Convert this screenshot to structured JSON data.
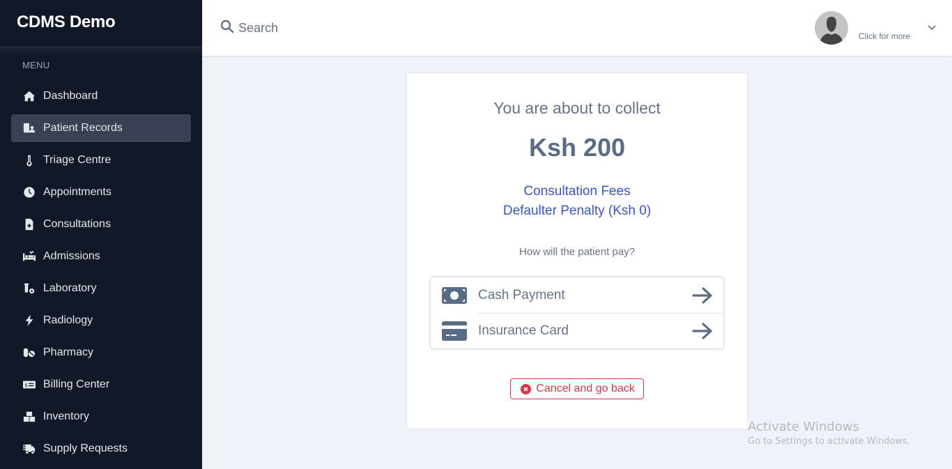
{
  "app": {
    "brand": "CDMS Demo",
    "menu_label": "MENU"
  },
  "sidebar": {
    "items": [
      {
        "label": "Dashboard",
        "icon": "home-icon",
        "active": false
      },
      {
        "label": "Patient Records",
        "icon": "patient-records-icon",
        "active": true
      },
      {
        "label": "Triage Centre",
        "icon": "thermometer-icon",
        "active": false
      },
      {
        "label": "Appointments",
        "icon": "clock-icon",
        "active": false
      },
      {
        "label": "Consultations",
        "icon": "file-medical-icon",
        "active": false
      },
      {
        "label": "Admissions",
        "icon": "hospital-bed-icon",
        "active": false
      },
      {
        "label": "Laboratory",
        "icon": "vial-gear-icon",
        "active": false
      },
      {
        "label": "Radiology",
        "icon": "bolt-icon",
        "active": false
      },
      {
        "label": "Pharmacy",
        "icon": "pills-icon",
        "active": false
      },
      {
        "label": "Billing Center",
        "icon": "money-check-icon",
        "active": false
      },
      {
        "label": "Inventory",
        "icon": "boxes-icon",
        "active": false
      },
      {
        "label": "Supply Requests",
        "icon": "shipping-truck-icon",
        "active": false
      }
    ]
  },
  "header": {
    "search_placeholder": "Search",
    "user_prompt": "Click for more"
  },
  "payment": {
    "lead": "You are about to collect",
    "amount": "Ksh 200",
    "line_items": [
      "Consultation Fees",
      "Defaulter Penalty (Ksh 0)"
    ],
    "question": "How will the patient pay?",
    "options": [
      {
        "label": "Cash Payment",
        "icon": "money-bill-icon"
      },
      {
        "label": "Insurance Card",
        "icon": "credit-card-icon"
      }
    ],
    "cancel_label": "Cancel and go back"
  },
  "watermark": {
    "title": "Activate Windows",
    "subtitle": "Go to Settings to activate Windows."
  },
  "colors": {
    "sidebar_bg": "#111827",
    "sidebar_active": "#374151",
    "accent_blue": "#3b55c8",
    "danger": "#dc3545",
    "text_slate": "#64748b"
  }
}
